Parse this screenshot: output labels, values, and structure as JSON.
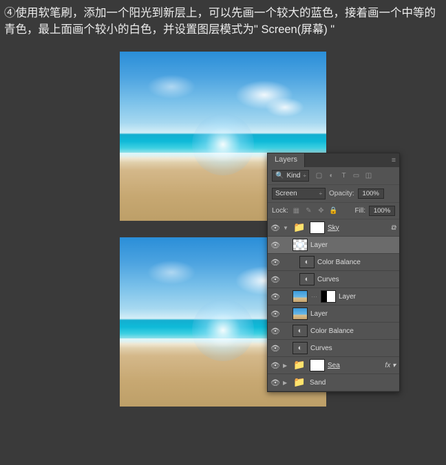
{
  "instruction_text": "④使用软笔刷，添加一个阳光到新层上，可以先画一个较大的蓝色，接着画一个中等的青色，最上面画个较小的白色，并设置图层模式为\" Screen(屏幕) \"",
  "panel": {
    "tab": "Layers",
    "filter_label": "Kind",
    "blend_mode": "Screen",
    "opacity_label": "Opacity:",
    "opacity_value": "100%",
    "lock_label": "Lock:",
    "fill_label": "Fill:",
    "fill_value": "100%"
  },
  "icons": {
    "menu": "≡",
    "search": "🔍",
    "img": "▢",
    "adj": "◐",
    "type": "T",
    "shape": "▭",
    "smart": "◫",
    "lock_trans": "▦",
    "lock_brush": "✎",
    "lock_move": "✥",
    "lock_all": "🔒",
    "chev": "÷",
    "eye": "👁",
    "tri_down": "▼",
    "tri_right": "▶",
    "folder": "📁",
    "adj_circle": "◐",
    "fx": "fx",
    "link": "⊂⊃"
  },
  "layers": [
    {
      "name": "Sky",
      "type": "group",
      "indent": 0,
      "open": true,
      "mask": "fill",
      "underline": true,
      "extra_icon": "link"
    },
    {
      "name": "Layer",
      "type": "check",
      "indent": 1,
      "selected": true
    },
    {
      "name": "Color Balance",
      "type": "adj",
      "indent": 2
    },
    {
      "name": "Curves",
      "type": "adj",
      "indent": 2
    },
    {
      "name": "Layer",
      "type": "sky",
      "indent": 1,
      "mask": "split-right"
    },
    {
      "name": "Layer",
      "type": "sky",
      "indent": 1
    },
    {
      "name": "Color Balance",
      "type": "adj",
      "indent": 1
    },
    {
      "name": "Curves",
      "type": "adj",
      "indent": 1
    },
    {
      "name": "Sea",
      "type": "group",
      "indent": 0,
      "open": false,
      "mask": "fill",
      "underline": true,
      "fx": true
    },
    {
      "name": "Sand",
      "type": "group",
      "indent": 0,
      "open": false
    }
  ]
}
